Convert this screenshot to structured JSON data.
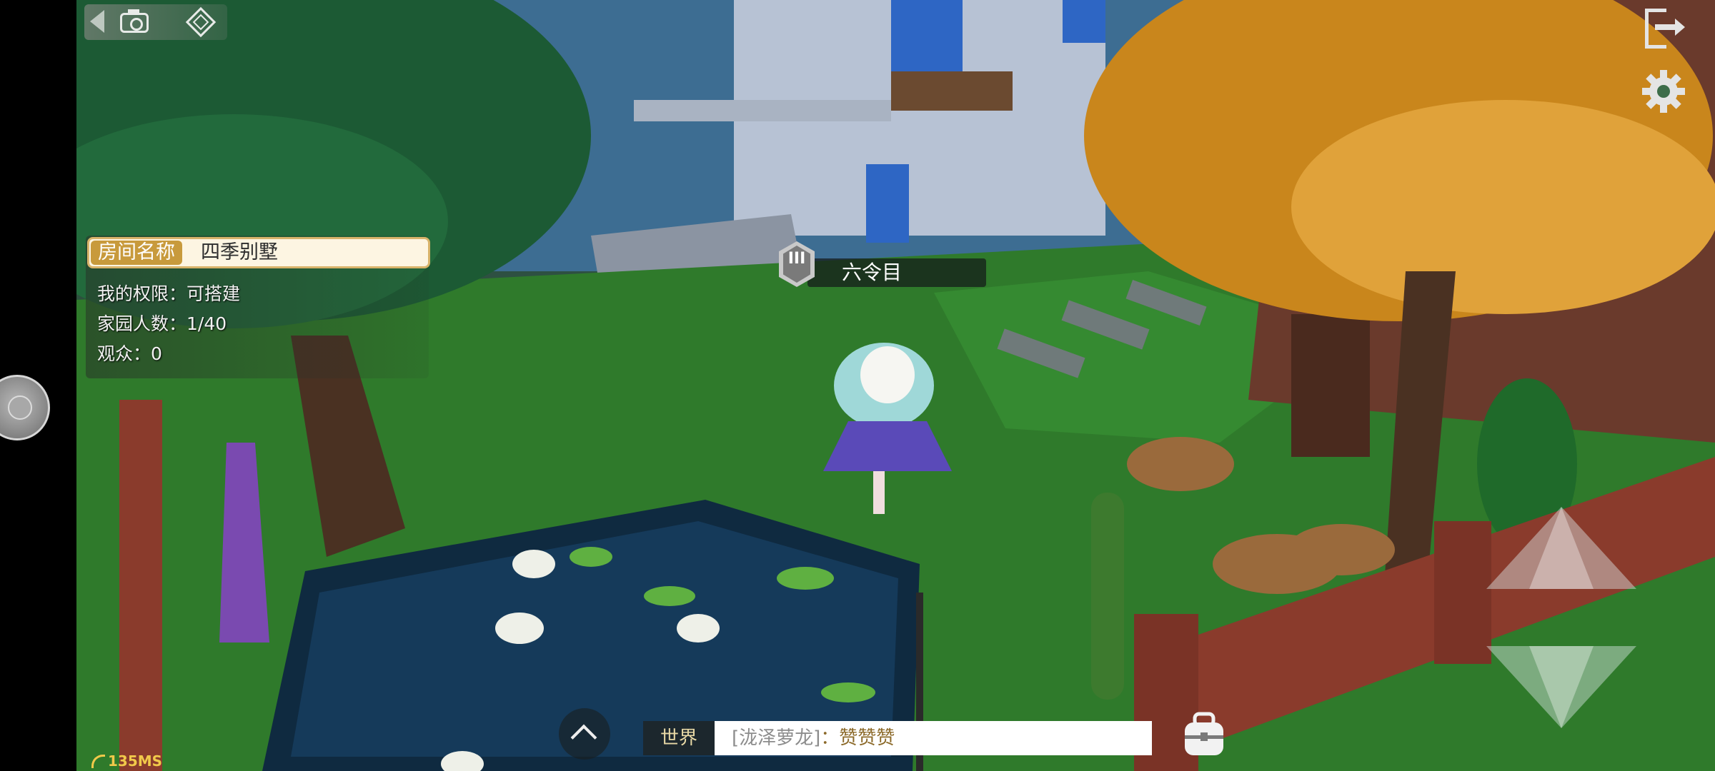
{
  "room_info": {
    "name_label": "房间名称",
    "name_value": "四季别墅",
    "permission": "我的权限：可搭建",
    "population": "家园人数：1/40",
    "audience": "观众：0"
  },
  "character": {
    "badge": "III",
    "name": "六令目"
  },
  "chat": {
    "channel": "世界",
    "sender": "[泷泽萝龙]",
    "message": "：赞赞赞"
  },
  "status": {
    "ping": "135MS"
  },
  "icons": {
    "top_left": [
      "back-chevron-icon",
      "camera-icon",
      "gamepad-icon"
    ],
    "top_right": [
      "exit-icon",
      "gear-icon"
    ],
    "bottom": [
      "chevron-up-icon",
      "backpack-icon"
    ],
    "movement": [
      "arrow-up-icon",
      "arrow-down-icon"
    ],
    "system": [
      "floating-assistant-ball"
    ]
  },
  "colors": {
    "room_tag": "#c89a3c",
    "room_bar_border": "#d8b36a",
    "chat_channel_text": "#e8d9a6",
    "chat_message_text": "#8c6a2a",
    "ping_text": "#f1c94a"
  }
}
